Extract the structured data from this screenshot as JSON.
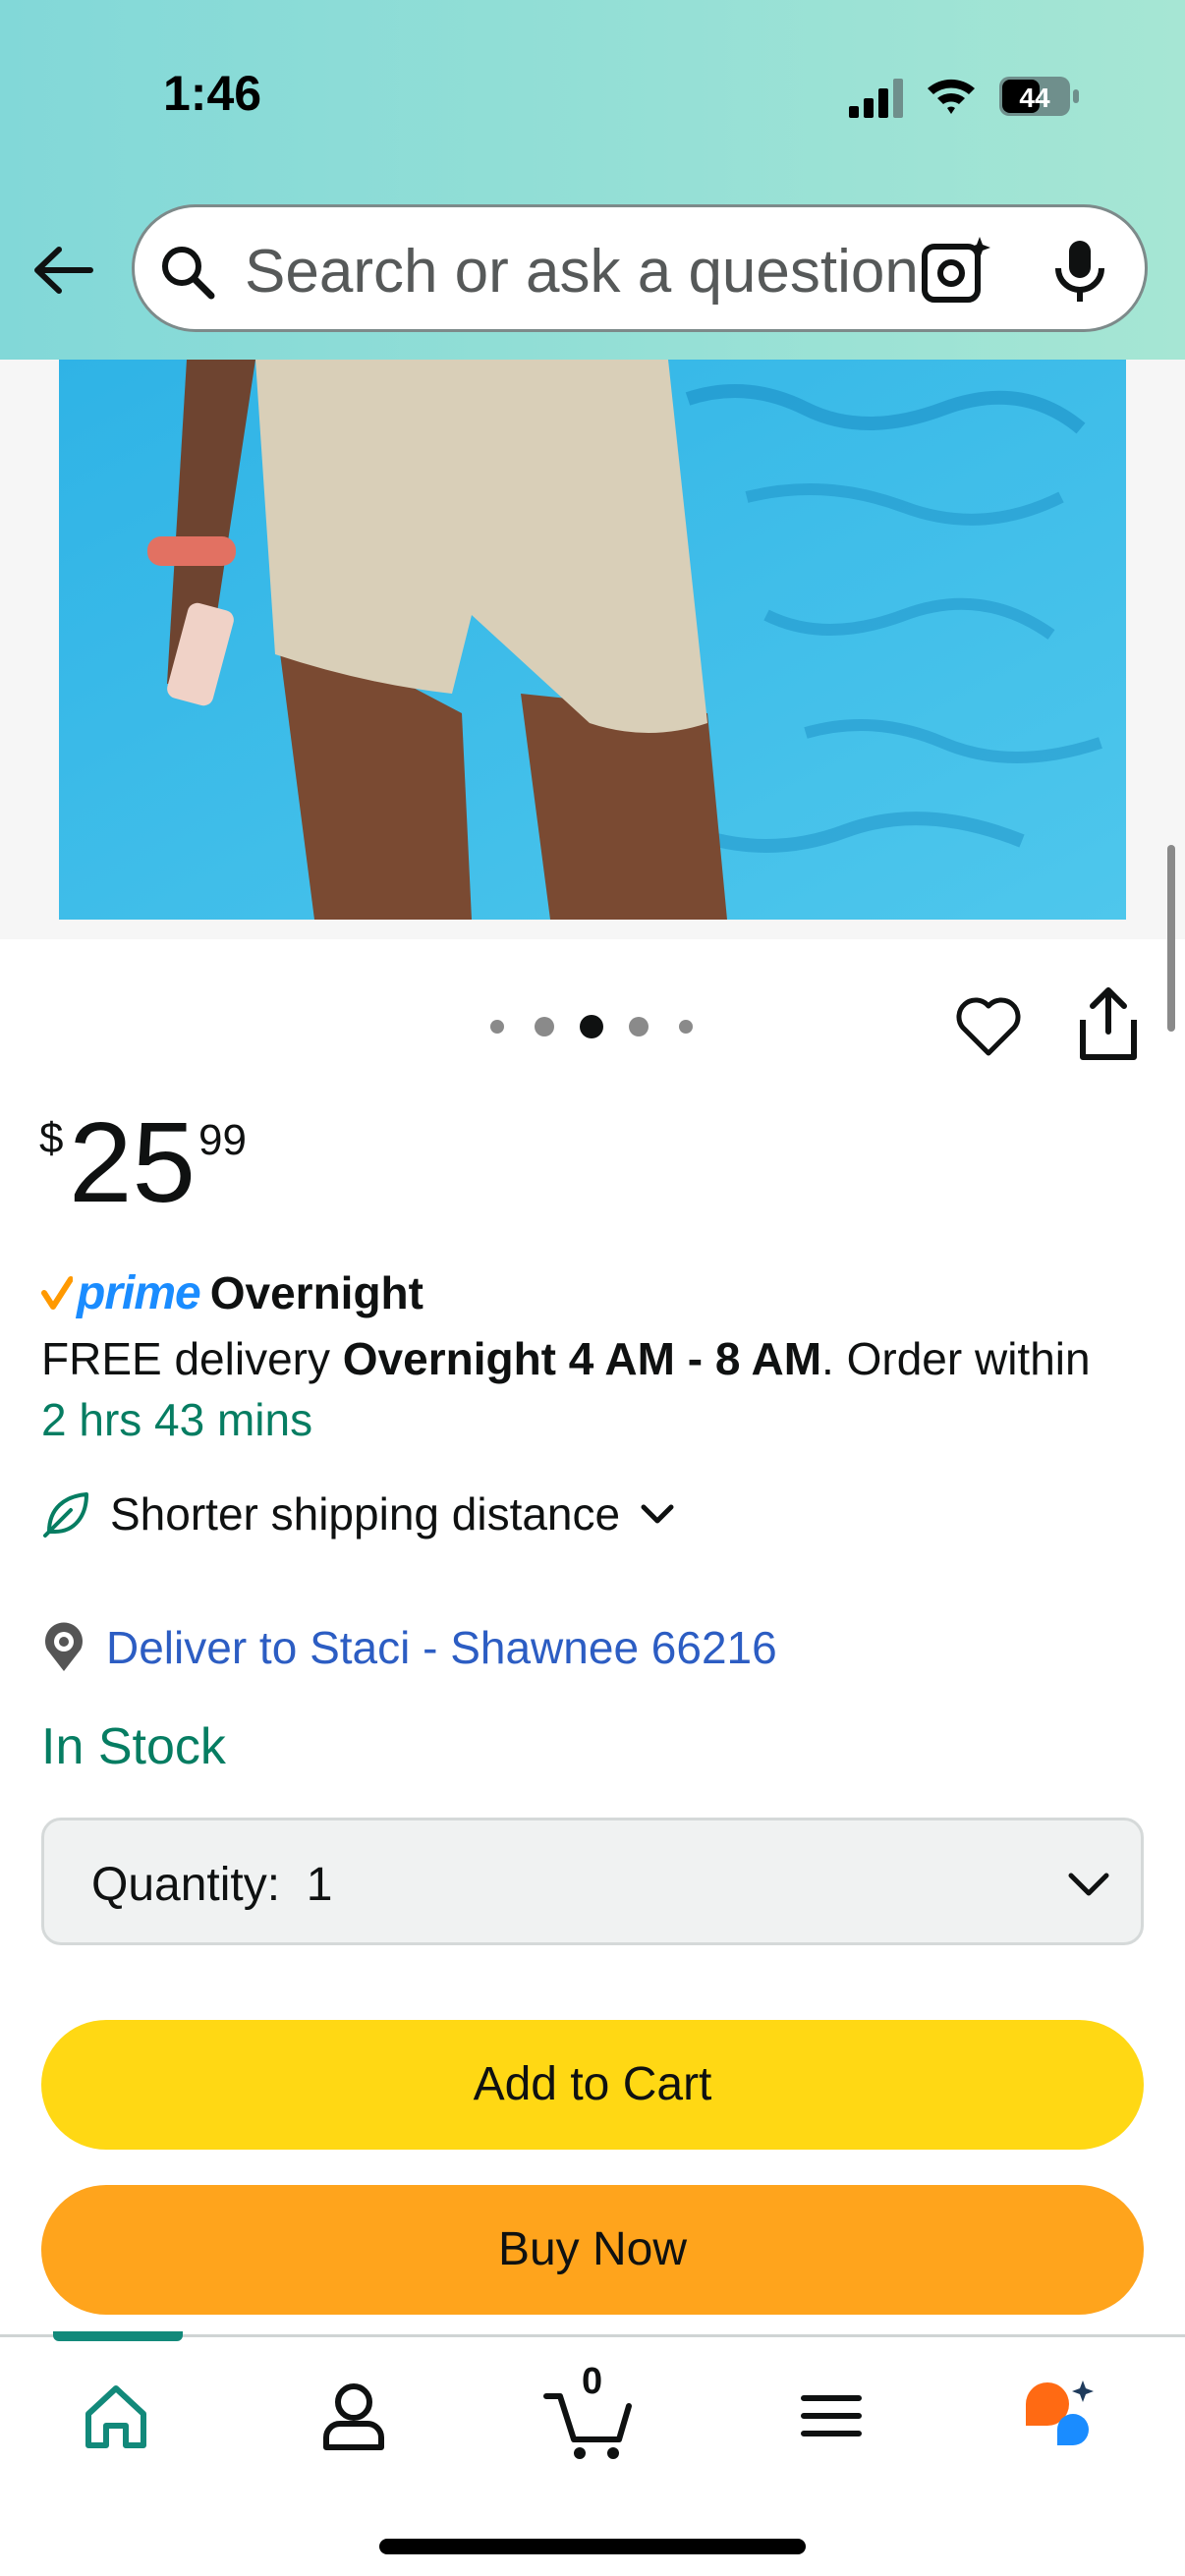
{
  "status_bar": {
    "time": "1:46",
    "battery": "44"
  },
  "search": {
    "placeholder": "Search or ask a question"
  },
  "product": {
    "image_dots_total": 5,
    "image_dots_active": 3,
    "price": {
      "symbol": "$",
      "whole": "25",
      "fraction": "99"
    }
  },
  "delivery": {
    "prime_label": "prime",
    "speed_label": "Overnight",
    "line_prefix": "FREE delivery ",
    "line_bold": "Overnight 4 AM - 8 AM",
    "line_suffix": ". Order within",
    "countdown": "2 hrs 43 mins",
    "shorter_shipping": "Shorter shipping distance",
    "deliver_to": "Deliver to Staci - Shawnee 66216"
  },
  "availability": "In Stock",
  "quantity": {
    "label": "Quantity:",
    "value": "1"
  },
  "buttons": {
    "add_to_cart": "Add to Cart",
    "buy_now": "Buy Now"
  },
  "bottom_nav": {
    "cart_count": "0",
    "items": [
      "home-icon",
      "account-icon",
      "cart-icon",
      "menu-icon",
      "rufus-icon"
    ]
  },
  "colors": {
    "header_gradient_start": "#82d8d8",
    "header_gradient_end": "#a6e6d4",
    "add_to_cart": "#FFD814",
    "buy_now": "#FFA41C",
    "in_stock": "#067D62",
    "link": "#2C5DC3",
    "prime_blue": "#1a8cff"
  }
}
